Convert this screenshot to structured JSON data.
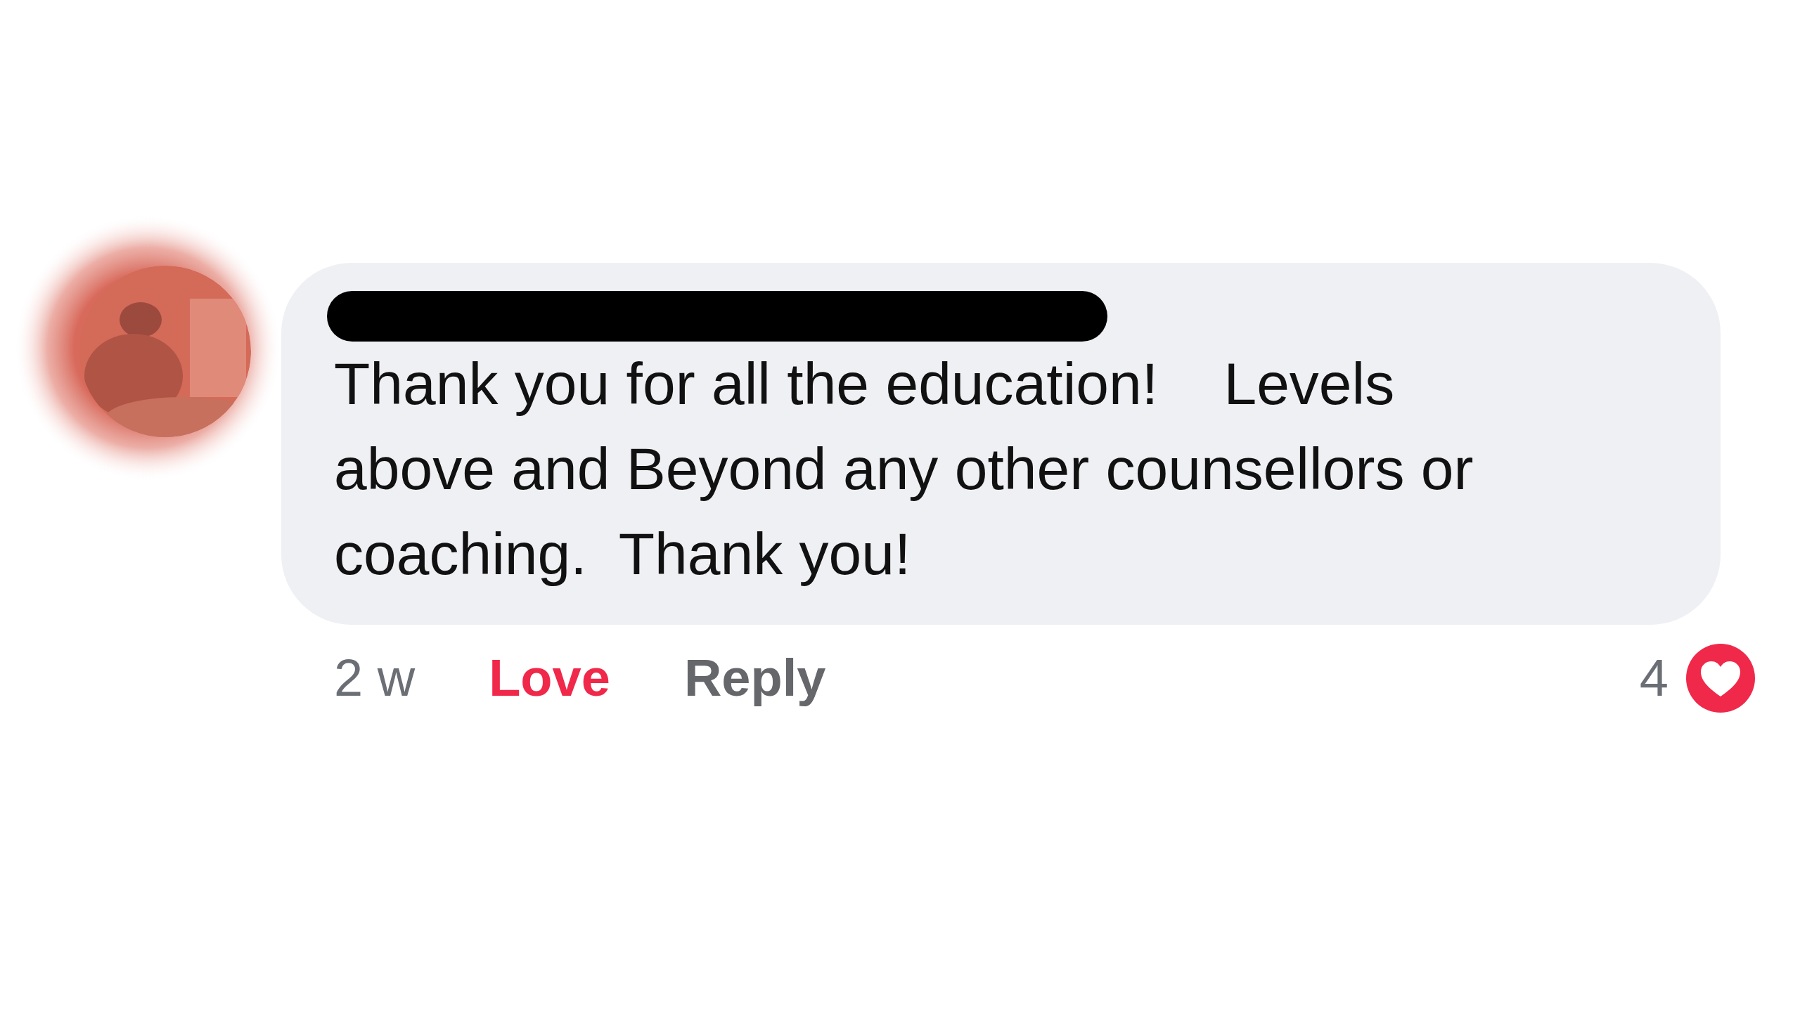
{
  "comment": {
    "name_redacted": true,
    "text": "Thank you for all the education!    Levels above and Beyond any other counsellors or coaching.  Thank you!"
  },
  "actions": {
    "time": "2 w",
    "like": {
      "label": "Love",
      "selected": true
    },
    "reply": {
      "label": "Reply"
    }
  },
  "reactions": {
    "count": "4",
    "kind": "love"
  }
}
